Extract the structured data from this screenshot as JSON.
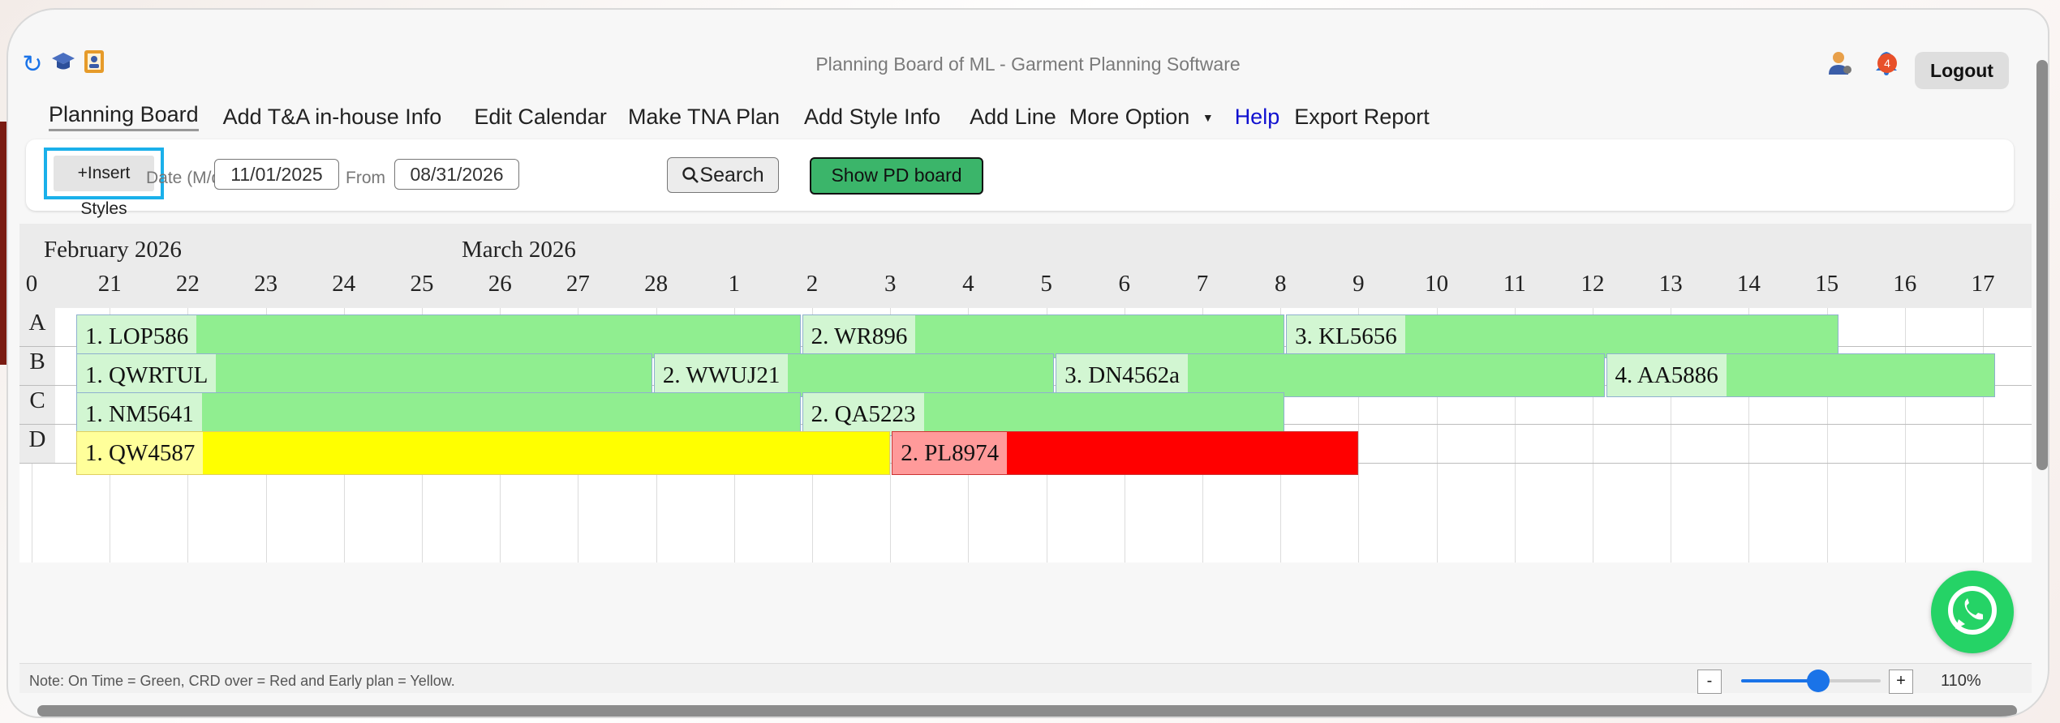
{
  "app": {
    "title": "Planning Board of ML - Garment Planning Software",
    "notification_count": "4",
    "logout_label": "Logout"
  },
  "nav": {
    "items": [
      {
        "label": "Planning Board",
        "active": true
      },
      {
        "label": "Add T&A in-house Info"
      },
      {
        "label": "Edit Calendar"
      },
      {
        "label": "Make TNA Plan"
      },
      {
        "label": "Add Style Info"
      },
      {
        "label": "Add Line"
      },
      {
        "label": "More Option",
        "dropdown": true
      },
      {
        "label": "Help",
        "color": "#1010d0"
      },
      {
        "label": "Export Report"
      }
    ],
    "dropdown_arrow": "▼"
  },
  "toolbar": {
    "insert_label": "+Insert Styles",
    "date_label": "Date (M/d/y):",
    "date_value": "11/01/2025",
    "from_label": "From",
    "from_value": "08/31/2026",
    "search_label": "Search",
    "show_pd_label": "Show PD board"
  },
  "board": {
    "months": [
      "February 2026",
      "March 2026"
    ],
    "days": [
      "0",
      "21",
      "22",
      "23",
      "24",
      "25",
      "26",
      "27",
      "28",
      "1",
      "2",
      "3",
      "4",
      "5",
      "6",
      "7",
      "8",
      "9",
      "10",
      "11",
      "12",
      "13",
      "14",
      "15",
      "16",
      "17"
    ],
    "rows": [
      {
        "label": "A",
        "bars": [
          {
            "text": "1. LOP586",
            "status": "green"
          },
          {
            "text": "2. WR896",
            "status": "green"
          },
          {
            "text": "3. KL5656",
            "status": "green"
          }
        ]
      },
      {
        "label": "B",
        "bars": [
          {
            "text": "1. QWRTUL",
            "status": "green"
          },
          {
            "text": "2. WWUJ21",
            "status": "green"
          },
          {
            "text": "3. DN4562a",
            "status": "green"
          },
          {
            "text": "4. AA5886",
            "status": "green"
          }
        ]
      },
      {
        "label": "C",
        "bars": [
          {
            "text": "1. NM5641",
            "status": "green"
          },
          {
            "text": "2. QA5223",
            "status": "green"
          }
        ]
      },
      {
        "label": "D",
        "bars": [
          {
            "text": "1. QW4587",
            "status": "yellow"
          },
          {
            "text": "2. PL8974",
            "status": "red"
          }
        ]
      }
    ]
  },
  "footer": {
    "note": "Note: On Time = Green, CRD over = Red and Early plan = Yellow.",
    "zoom_minus": "-",
    "zoom_plus": "+",
    "zoom_level": "110%",
    "zoom_fraction": 0.55
  },
  "colors": {
    "on_time": "#90ee90",
    "crd_over": "#ff0000",
    "early_plan": "#ffff00",
    "highlight": "#1ab0ea"
  },
  "icons": [
    "refresh-icon",
    "graduation-icon",
    "address-book-icon",
    "user-settings-icon",
    "bell-icon",
    "search-icon",
    "whatsapp-icon"
  ]
}
